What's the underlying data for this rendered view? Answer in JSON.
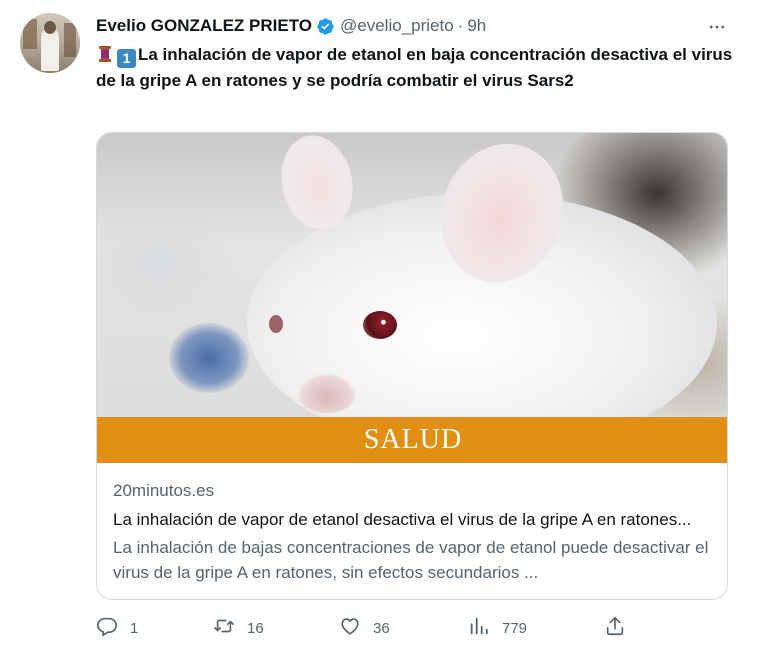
{
  "author": {
    "display_name": "Evelio GONZALEZ PRIETO",
    "handle": "@evelio_prieto",
    "separator": "·",
    "time": "9h",
    "verified": true
  },
  "tweet": {
    "emoji_one": "1",
    "text": "La inhalación de vapor de etanol en baja concentración desactiva el virus de la gripe A en ratones y se podría combatir el virus Sars2"
  },
  "card": {
    "banner_label": "SALUD",
    "domain": "20minutos.es",
    "title": "La inhalación de vapor de etanol desactiva el virus de la gripe A en ratones...",
    "description": "La inhalación de bajas concentraciones de vapor de etanol puede desactivar el virus de la gripe A en ratones, sin efectos secundarios ..."
  },
  "actions": {
    "replies": "1",
    "retweets": "16",
    "likes": "36",
    "views": "779"
  },
  "colors": {
    "verified_blue": "#1d9bf0",
    "banner_orange": "#e08f12",
    "text_primary": "#0f1419",
    "text_secondary": "#536471"
  }
}
